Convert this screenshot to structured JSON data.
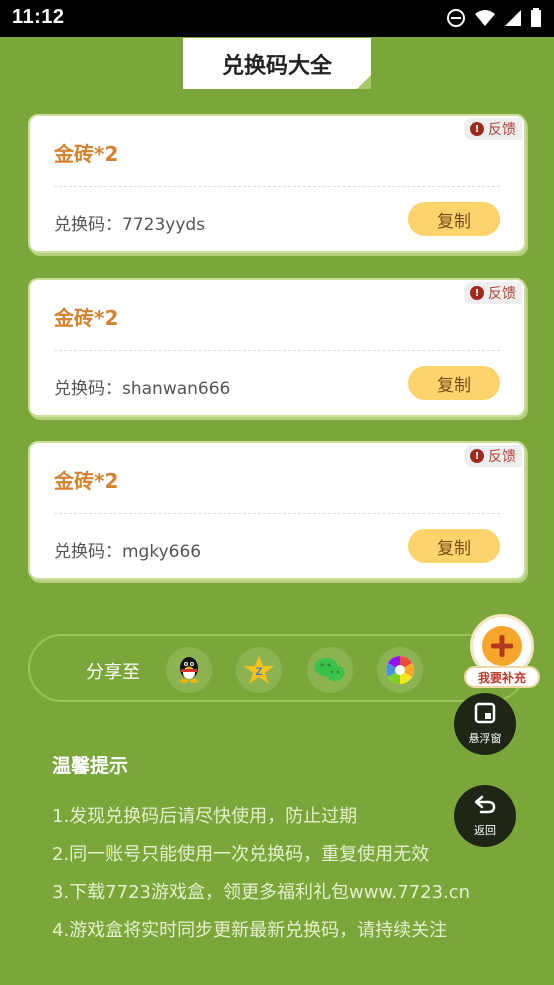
{
  "status_bar": {
    "time": "11:12"
  },
  "header": {
    "title": "兑换码大全"
  },
  "cards": [
    {
      "title": "金砖*2",
      "code_label": "兑换码：7723yyds",
      "copy_label": "复制",
      "feedback_label": "反馈"
    },
    {
      "title": "金砖*2",
      "code_label": "兑换码：shanwan666",
      "copy_label": "复制",
      "feedback_label": "反馈"
    },
    {
      "title": "金砖*2",
      "code_label": "兑换码：mgky666",
      "copy_label": "复制",
      "feedback_label": "反馈"
    }
  ],
  "share": {
    "label": "分享至",
    "targets": [
      "qq-icon",
      "qzone-icon",
      "wechat-icon",
      "moments-icon"
    ]
  },
  "tips": {
    "title": "温馨提示",
    "items": [
      "1.发现兑换码后请尽快使用，防止过期",
      "2.同一账号只能使用一次兑换码，重复使用无效",
      "3.下载7723游戏盒，领更多福利礼包www.7723.cn",
      "4.游戏盒将实时同步更新最新兑换码，请持续关注"
    ]
  },
  "floating": {
    "add_label": "我要补充",
    "window_label": "悬浮窗",
    "back_label": "返回"
  },
  "colors": {
    "background": "#7aa63a",
    "card_title": "#d4822f",
    "copy_button": "#ffd36c",
    "feedback_text": "#b0433a"
  }
}
